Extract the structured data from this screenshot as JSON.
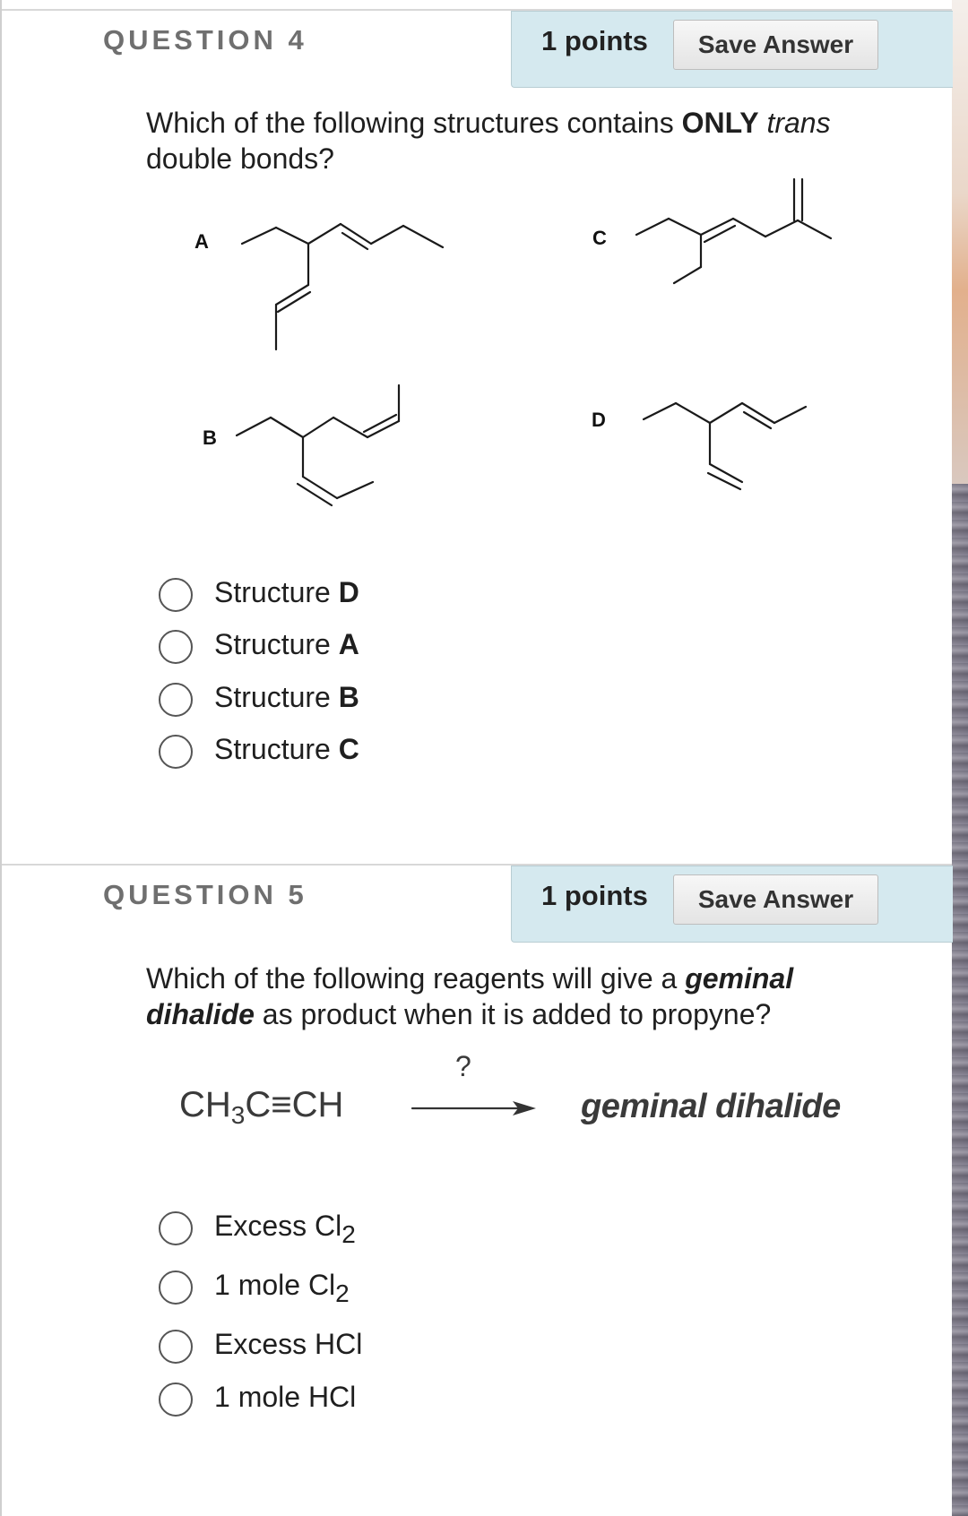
{
  "questions": [
    {
      "title": "QUESTION 4",
      "points": "1 points",
      "save_label": "Save Answer",
      "prompt": {
        "part1": "Which of the following structures contains ",
        "bold": "ONLY",
        "space": " ",
        "italic": "trans",
        "part2": " double bonds?"
      },
      "structure_labels": [
        "A",
        "B",
        "C",
        "D"
      ],
      "options": [
        {
          "prefix": "Structure ",
          "letter": "D"
        },
        {
          "prefix": "Structure ",
          "letter": "A"
        },
        {
          "prefix": "Structure ",
          "letter": "B"
        },
        {
          "prefix": "Structure ",
          "letter": "C"
        }
      ]
    },
    {
      "title": "QUESTION 5",
      "points": "1 points",
      "save_label": "Save Answer",
      "prompt": {
        "part1": "Which of the following reagents will give a ",
        "bold_italic": "geminal dihalide",
        "part2": " as product when it is added to propyne?"
      },
      "reaction": {
        "reactant_a": "CH",
        "reactant_sub": "3",
        "reactant_b": "C≡CH",
        "reagent": "?",
        "product": "geminal dihalide"
      },
      "options": [
        {
          "text": "Excess Cl",
          "sub": "2"
        },
        {
          "text": "1 mole Cl",
          "sub": "2"
        },
        {
          "text": "Excess HCl",
          "sub": ""
        },
        {
          "text": "1 mole HCl",
          "sub": ""
        }
      ]
    }
  ]
}
